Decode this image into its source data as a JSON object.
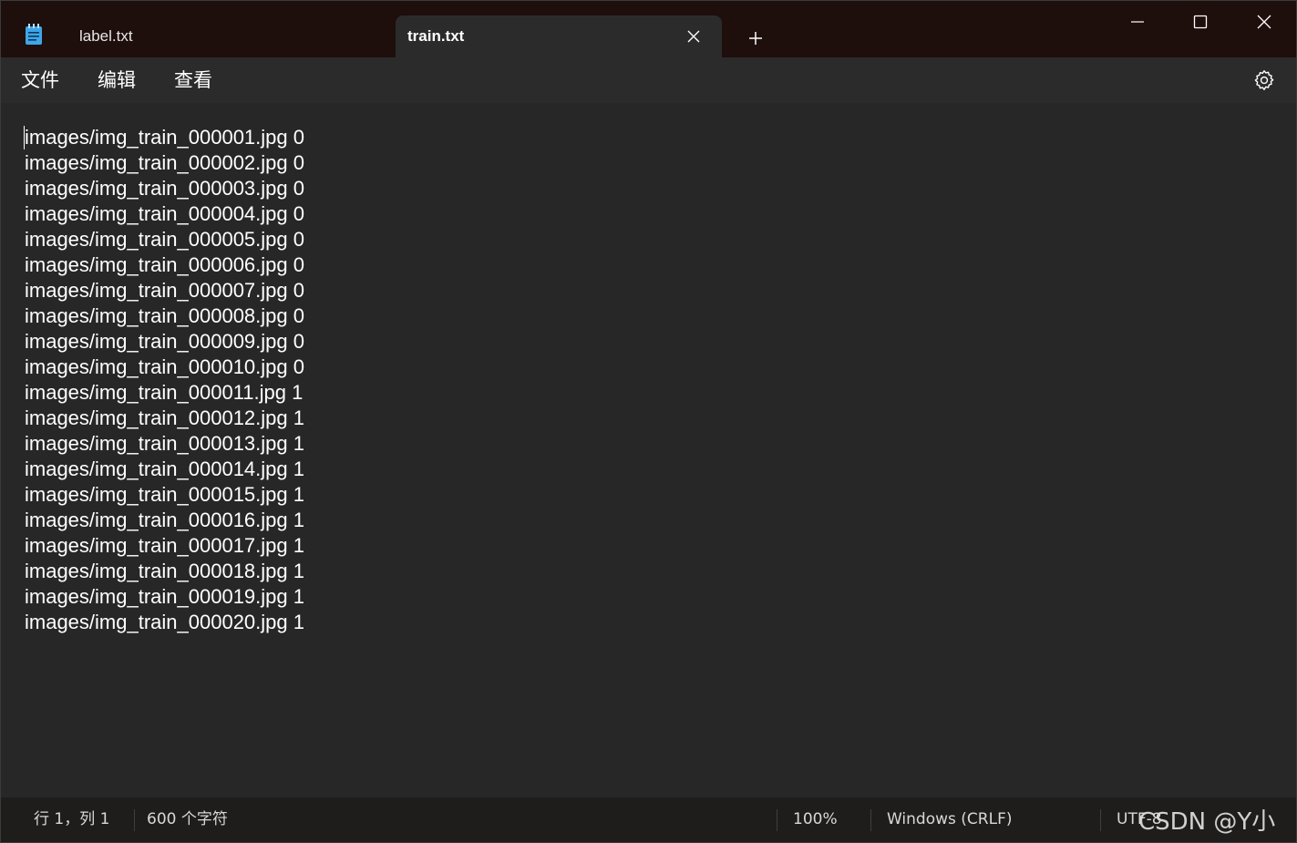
{
  "app": {
    "icon": "notepad-icon"
  },
  "tabs": [
    {
      "label": "label.txt",
      "active": false
    },
    {
      "label": "train.txt",
      "active": true
    }
  ],
  "window_controls": {
    "minimize_icon": "minimize-icon",
    "maximize_icon": "maximize-icon",
    "close_icon": "close-icon",
    "new_tab_icon": "plus-icon"
  },
  "menu": {
    "file": "文件",
    "edit": "编辑",
    "view": "查看",
    "settings_icon": "gear-icon"
  },
  "editor": {
    "lines": [
      "images/img_train_000001.jpg 0",
      "images/img_train_000002.jpg 0",
      "images/img_train_000003.jpg 0",
      "images/img_train_000004.jpg 0",
      "images/img_train_000005.jpg 0",
      "images/img_train_000006.jpg 0",
      "images/img_train_000007.jpg 0",
      "images/img_train_000008.jpg 0",
      "images/img_train_000009.jpg 0",
      "images/img_train_000010.jpg 0",
      "images/img_train_000011.jpg 1",
      "images/img_train_000012.jpg 1",
      "images/img_train_000013.jpg 1",
      "images/img_train_000014.jpg 1",
      "images/img_train_000015.jpg 1",
      "images/img_train_000016.jpg 1",
      "images/img_train_000017.jpg 1",
      "images/img_train_000018.jpg 1",
      "images/img_train_000019.jpg 1",
      "images/img_train_000020.jpg 1"
    ]
  },
  "status": {
    "position": "行 1，列 1",
    "char_count": "600 个字符",
    "zoom": "100%",
    "line_ending": "Windows (CRLF)",
    "encoding": "UTF-8"
  },
  "watermark": "CSDN @Y小夜",
  "colors": {
    "titlebar": "#1e0f0c",
    "editor_bg": "#272727",
    "text": "#ffffff"
  }
}
